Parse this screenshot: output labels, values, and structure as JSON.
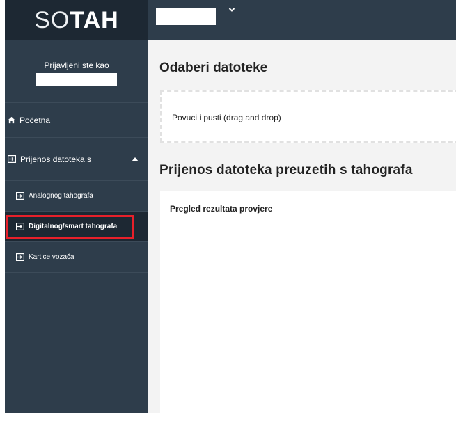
{
  "logo": {
    "part1": "SO",
    "part2": "TAH"
  },
  "user": {
    "label": "Prijavljeni ste kao",
    "name": ""
  },
  "nav": {
    "home": "Početna",
    "group": "Prijenos datoteka s",
    "items": [
      {
        "label": "Analognog tahografa"
      },
      {
        "label": "Digitalnog/smart tahografa"
      },
      {
        "label": "Kartice vozača"
      }
    ]
  },
  "topbar": {
    "selected": ""
  },
  "main": {
    "section1_title": "Odaberi datoteke",
    "dropzone_text": "Povuci i pusti (drag and drop)",
    "section2_title": "Prijenos datoteka preuzetih s tahografa",
    "panel_title": "Pregled rezultata provjere"
  },
  "colors": {
    "sidebar": "#2e3d4b",
    "sidebar_dark": "#1d2833",
    "highlight": "#e8202a",
    "background": "#f3f3f3"
  },
  "icons": {
    "home": "home-icon",
    "enter": "enter-icon",
    "caret": "caret-up-icon",
    "chevron": "chevron-down-icon"
  }
}
